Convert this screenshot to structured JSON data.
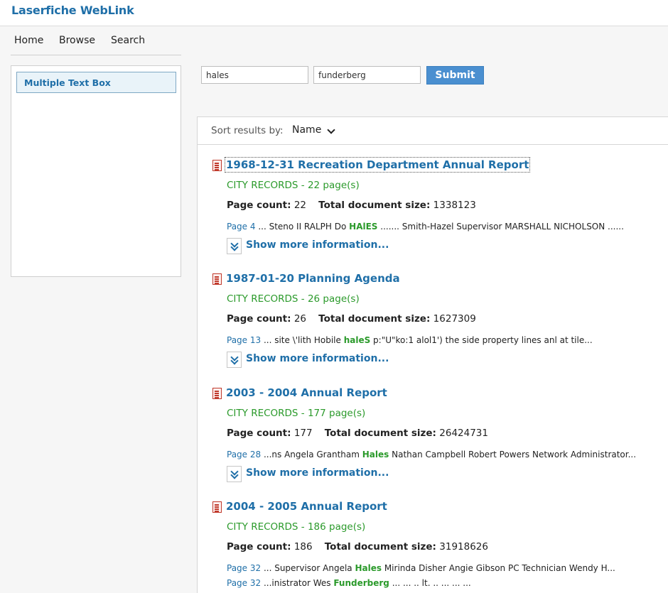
{
  "app": {
    "title_part1": "Laserfiche",
    "title_part2": "WebLink"
  },
  "nav": {
    "home": "Home",
    "browse": "Browse",
    "search": "Search"
  },
  "left_box": {
    "item": "Multiple Text Box"
  },
  "search": {
    "field1_value": "hales",
    "field2_value": "funderberg",
    "submit_label": "Submit"
  },
  "sort": {
    "label": "Sort results by:",
    "value": "Name"
  },
  "labels": {
    "page_count": "Page count:",
    "total_size": "Total document size:",
    "show_more": "Show more information..."
  },
  "results": [
    {
      "title": "1968-12-31 Recreation Department Annual Report",
      "subtitle": "CITY RECORDS - 22 page(s)",
      "page_count": "22",
      "total_size": "1338123",
      "snippets": [
        {
          "page": "Page 4",
          "pre": " ... Steno II RALPH Do ",
          "hl": "HAlES",
          "post": " ....... Smith-Hazel Supervisor MARSHALL NICHOLSON ......"
        }
      ]
    },
    {
      "title": "1987-01-20 Planning Agenda",
      "subtitle": "CITY RECORDS - 26 page(s)",
      "page_count": "26",
      "total_size": "1627309",
      "snippets": [
        {
          "page": "Page 13",
          "pre": " ... site \\'lith Hobile ",
          "hl": "haleS",
          "post": " p:\"U\"ko:1 alol1') the side property lines anl at tile..."
        }
      ]
    },
    {
      "title": "2003 - 2004 Annual Report",
      "subtitle": "CITY RECORDS - 177 page(s)",
      "page_count": "177",
      "total_size": "26424731",
      "snippets": [
        {
          "page": "Page 28",
          "pre": " ...ns Angela Grantham ",
          "hl": "Hales",
          "post": " Nathan Campbell Robert Powers Network Administrator..."
        }
      ]
    },
    {
      "title": "2004 - 2005 Annual Report",
      "subtitle": "CITY RECORDS - 186 page(s)",
      "page_count": "186",
      "total_size": "31918626",
      "snippets": [
        {
          "page": "Page 32",
          "pre": " ... Supervisor Angela ",
          "hl": "Hales",
          "post": " Mirinda Disher Angie Gibson PC Technician Wendy H..."
        },
        {
          "page": "Page 32",
          "pre": " ...inistrator Wes ",
          "hl": "Funderberg",
          "post": " ... ... .. lt. .. ... ... ..."
        }
      ]
    }
  ]
}
